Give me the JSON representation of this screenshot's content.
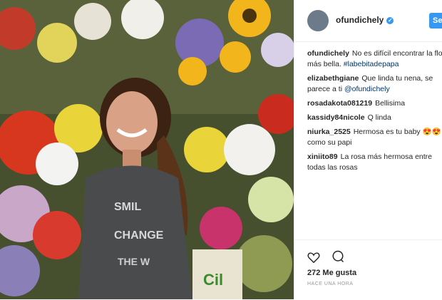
{
  "post": {
    "username": "ofundichely",
    "follow_label": "Se",
    "caption_text": "No es difícil encontrar la flor más bella.",
    "caption_hashtag": "#labebitadepapa",
    "likes": "272 Me gusta",
    "time": "HACE UNA HORA"
  },
  "photo": {
    "shirt_line1": "SMIL",
    "shirt_line2": "CHANGE",
    "shirt_line3": "THE W",
    "bucket_text": "Cil"
  },
  "comments": [
    {
      "user": "elizabethgiane",
      "text": "Que linda tu nena, se parece a ti",
      "mention": "@ofundichely"
    },
    {
      "user": "rosadakota081219",
      "text": "Bellisima",
      "mention": ""
    },
    {
      "user": "kassidy84nicole",
      "text": "Q linda",
      "mention": ""
    },
    {
      "user": "niurka_2525",
      "text": "Hermosa es tu baby 😍😍 como su papi",
      "mention": ""
    },
    {
      "user": "xiniito89",
      "text": "La rosa más hermosa entre todas las rosas",
      "mention": ""
    }
  ],
  "icons": [
    "heart-icon",
    "comment-icon",
    "verified-badge-icon"
  ],
  "colors": {
    "accent": "#3897f0",
    "hashtag": "#003569"
  }
}
